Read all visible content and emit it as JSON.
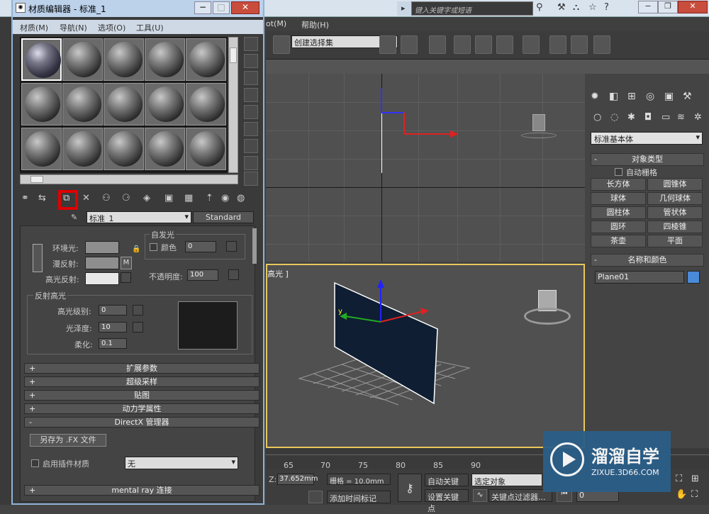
{
  "app": {
    "search_placeholder": "键入关键字或短语",
    "menu_partial_1": "ot(M)",
    "menu_help": "帮助(H)"
  },
  "toolbar": {
    "selection_set": "创建选择集"
  },
  "material_editor": {
    "title": "材质编辑器 - 标准_1",
    "menu": [
      "材质(M)",
      "导航(N)",
      "选项(O)",
      "工具(U)"
    ],
    "material_name": "标准_1",
    "shader_type": "Standard",
    "basic_params": {
      "ambient_label": "环境光:",
      "diffuse_label": "漫反射:",
      "specular_label": "高光反射:",
      "map_button": "M",
      "self_illum_title": "自发光",
      "color_label": "颜色",
      "color_value": "0",
      "opacity_label": "不透明度:",
      "opacity_value": "100"
    },
    "specular_highlights": {
      "title": "反射高光",
      "level_label": "高光级别:",
      "level_value": "0",
      "gloss_label": "光泽度:",
      "gloss_value": "10",
      "soften_label": "柔化:",
      "soften_value": "0.1"
    },
    "rollouts": [
      "扩展参数",
      "超级采样",
      "贴图",
      "动力学属性"
    ],
    "directx": {
      "title": "DirectX 管理器",
      "save_fx": "另存为 .FX 文件",
      "enable_plugin": "启用插件材质",
      "plugin_value": "无"
    },
    "mental_ray": "mental ray 连接"
  },
  "viewport": {
    "label": "高光 ]"
  },
  "command_panel": {
    "category": "标准基本体",
    "object_type_title": "对象类型",
    "auto_grid": "自动栅格",
    "buttons": [
      "长方体",
      "圆锥体",
      "球体",
      "几何球体",
      "圆柱体",
      "管状体",
      "圆环",
      "四棱锥",
      "茶壶",
      "平面"
    ],
    "name_color_title": "名称和颜色",
    "object_name": "Plane01",
    "object_color": "#4a8ad8"
  },
  "timeline": {
    "ticks": [
      "65",
      "70",
      "75",
      "80",
      "85",
      "90"
    ]
  },
  "status": {
    "z_label": "Z:",
    "z_value": "37.652mm",
    "grid_label": "栅格 = 10.0mm",
    "auto_key": "自动关键点",
    "selected_object": "选定对象",
    "set_key": "设置关键点",
    "key_filters": "关键点过滤器...",
    "add_time_tag": "添加时间标记",
    "frame_value": "0"
  },
  "watermark": {
    "brand": "溜溜自学",
    "url": "ZIXUE.3D66.COM"
  }
}
